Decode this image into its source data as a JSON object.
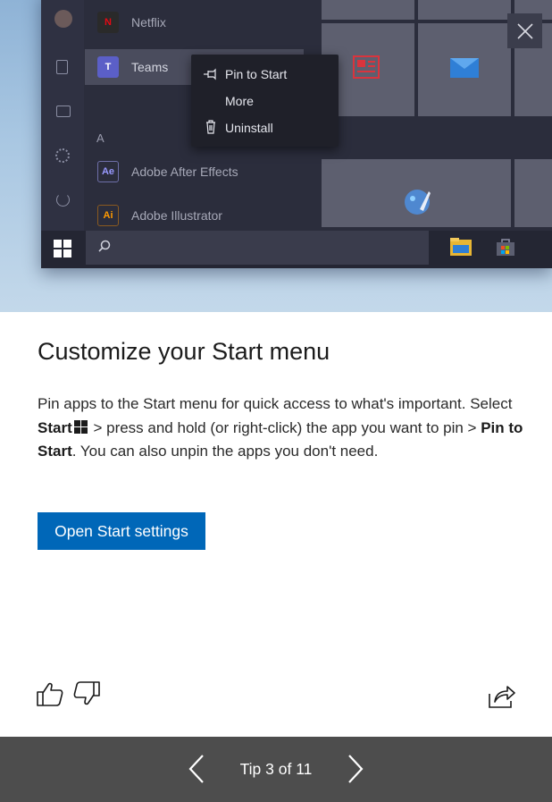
{
  "hero": {
    "apps": [
      {
        "label": "Netflix",
        "tile_text": "N",
        "tile_color": "#2a2a2a",
        "text_color": "#e50914"
      },
      {
        "label": "Teams",
        "tile_text": "T",
        "tile_color": "#5b5fc7",
        "text_color": "#ffffff"
      },
      {
        "label": "Adobe After Effects",
        "tile_text": "Ae",
        "tile_color": "#2b2d3c",
        "text_color": "#9999ff"
      },
      {
        "label": "Adobe Illustrator",
        "tile_text": "Ai",
        "tile_color": "#2b2d3c",
        "text_color": "#ff9a00"
      }
    ],
    "section_letter": "A",
    "context_menu": {
      "items": [
        {
          "label": "Pin to Start",
          "icon": "pin-icon"
        },
        {
          "label": "More",
          "icon": ""
        },
        {
          "label": "Uninstall",
          "icon": "trash-icon"
        }
      ]
    }
  },
  "content": {
    "title": "Customize your Start menu",
    "desc_part1": "Pin apps to the Start menu for quick access to what's important. Select ",
    "desc_bold1": "Start",
    "desc_part2": " > press and hold (or right-click) the app you want to pin > ",
    "desc_bold2": "Pin to Start",
    "desc_part3": ". You can also unpin the apps you don't need.",
    "button_label": "Open Start settings"
  },
  "footer": {
    "tip_counter": "Tip 3 of 11"
  },
  "colors": {
    "accent": "#0067b8",
    "footer_bg": "#4d4d4d"
  }
}
